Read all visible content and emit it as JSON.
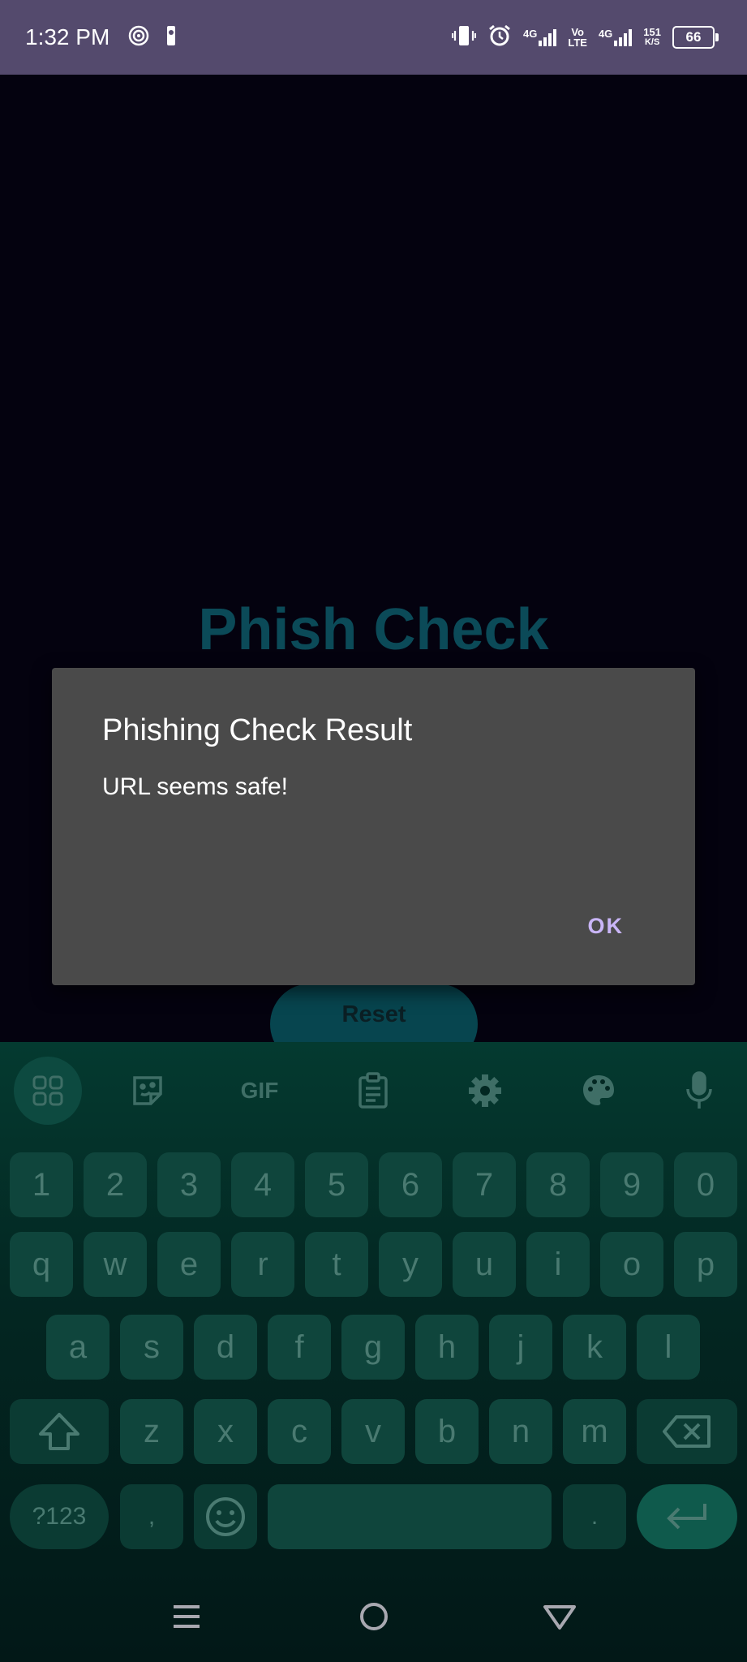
{
  "status_bar": {
    "time": "1:32 PM",
    "network_1": "4G",
    "volte_top": "Vo",
    "volte_bottom": "LTE",
    "network_2": "4G",
    "speed_value": "151",
    "speed_unit": "K/S",
    "battery": "66"
  },
  "app": {
    "title": "Phish Check",
    "reset_label": "Reset"
  },
  "dialog": {
    "title": "Phishing Check Result",
    "message": "URL seems safe!",
    "ok_label": "OK"
  },
  "keyboard": {
    "gif_label": "GIF",
    "numbers": [
      "1",
      "2",
      "3",
      "4",
      "5",
      "6",
      "7",
      "8",
      "9",
      "0"
    ],
    "row1": [
      "q",
      "w",
      "e",
      "r",
      "t",
      "y",
      "u",
      "i",
      "o",
      "p"
    ],
    "row2": [
      "a",
      "s",
      "d",
      "f",
      "g",
      "h",
      "j",
      "k",
      "l"
    ],
    "row3": [
      "z",
      "x",
      "c",
      "v",
      "b",
      "n",
      "m"
    ],
    "symbols_label": "?123",
    "comma_label": ",",
    "period_label": "."
  },
  "colors": {
    "status_bar": "#544a6d",
    "background": "#04020f",
    "title": "#0b4a58",
    "dialog": "#4a4a4a",
    "dialog_accent": "#c9b5f7",
    "keyboard_bg": "#032722",
    "key": "#0f453c"
  },
  "icons": {
    "status_left": [
      "hotspot-icon",
      "basketball-icon"
    ],
    "status_right": [
      "vibrate-icon",
      "alarm-icon",
      "signal-icon",
      "battery-icon"
    ],
    "toolbar": [
      "apps-grid-icon",
      "sticker-icon",
      "gif-icon",
      "clipboard-icon",
      "settings-gear-icon",
      "palette-icon",
      "microphone-icon"
    ],
    "keys": [
      "shift-icon",
      "backspace-icon",
      "emoji-icon",
      "enter-icon"
    ],
    "nav": [
      "menu-icon",
      "home-icon",
      "back-icon"
    ]
  }
}
